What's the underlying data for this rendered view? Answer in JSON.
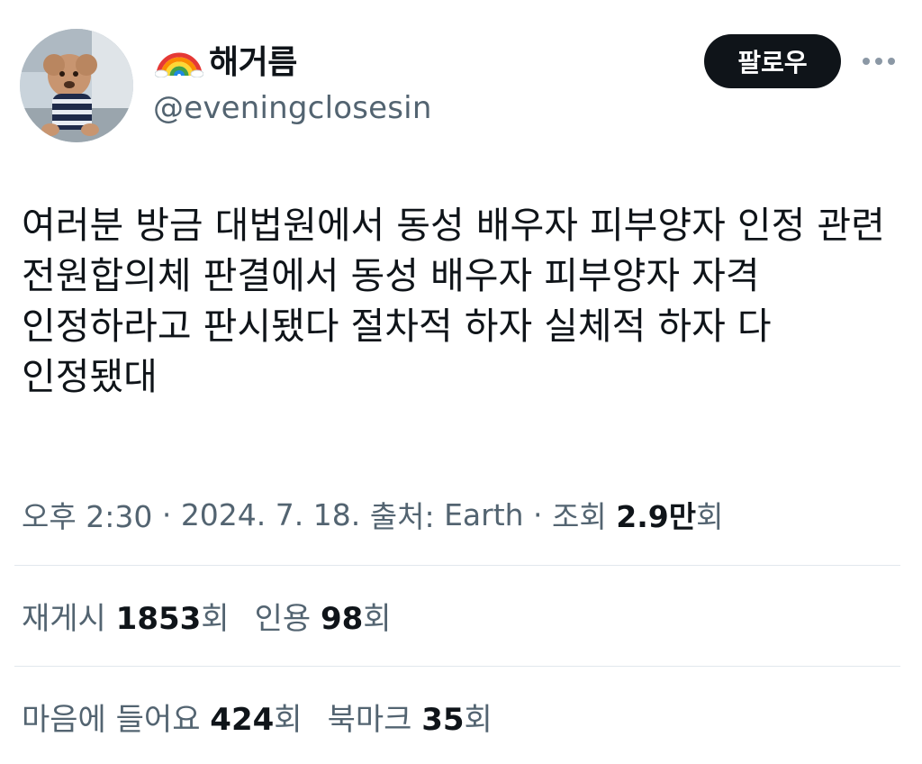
{
  "user": {
    "display_name": "해거름",
    "name_emoji": "rainbow-icon",
    "handle": "@eveningclosesin",
    "avatar": "avatar-photo"
  },
  "actions": {
    "follow_label": "팔로우",
    "more_icon": "more-horizontal-icon"
  },
  "tweet": {
    "text": "여러분 방금 대법원에서 동성 배우자 피부양자 인정 관련 전원합의체 판결에서 동성 배우자 피부양자 자격 인정하라고 판시됐다 절차적 하자 실체적 하자 다 인정됐대"
  },
  "meta": {
    "time": "오후 2:30",
    "sep1": " · ",
    "date": "2024. 7. 18.",
    "source_label": " 출처: ",
    "source": "Earth",
    "sep2": " · ",
    "views_label": "조회 ",
    "views_value": "2.9만",
    "views_suffix": "회"
  },
  "stats": {
    "retweets_label": "재게시 ",
    "retweets_value": "1853",
    "retweets_suffix": "회",
    "quotes_label": "인용 ",
    "quotes_value": "98",
    "quotes_suffix": "회",
    "likes_label": "마음에 들어요 ",
    "likes_value": "424",
    "likes_suffix": "회",
    "bookmarks_label": "북마크 ",
    "bookmarks_value": "35",
    "bookmarks_suffix": "회"
  },
  "colors": {
    "text_primary": "#0f1419",
    "text_secondary": "#536471",
    "follow_bg": "#0f1419",
    "divider": "#e1e8ed"
  }
}
